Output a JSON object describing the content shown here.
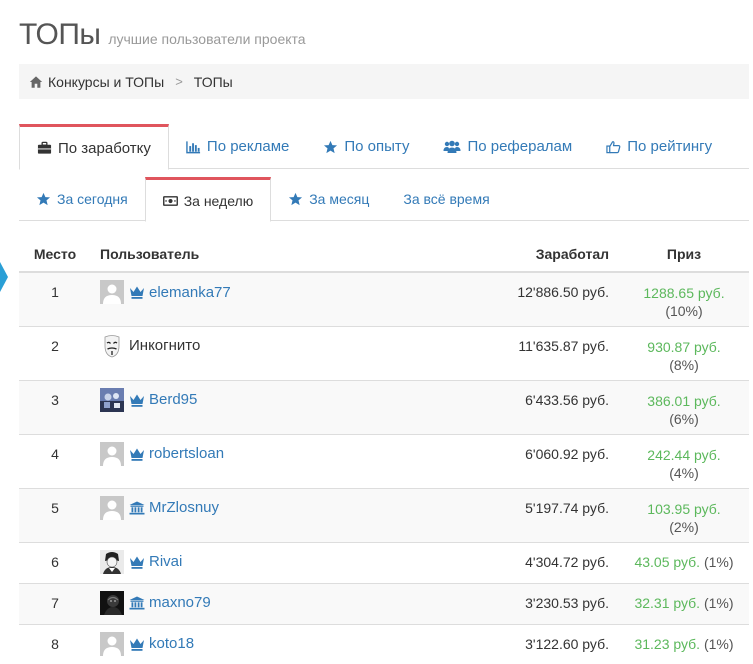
{
  "header": {
    "title": "ТОПы",
    "subtitle": "лучшие пользователи проекта"
  },
  "breadcrumb": {
    "home_label": "Конкурсы и ТОПы",
    "separator": ">",
    "current": "ТОПы"
  },
  "category_tabs": [
    {
      "label": "По заработку",
      "icon": "briefcase-icon",
      "active": true
    },
    {
      "label": "По рекламе",
      "icon": "bar-chart-icon",
      "active": false
    },
    {
      "label": "По опыту",
      "icon": "star-icon",
      "active": false
    },
    {
      "label": "По рефералам",
      "icon": "users-icon",
      "active": false
    },
    {
      "label": "По рейтингу",
      "icon": "thumbs-up-icon",
      "active": false
    }
  ],
  "period_tabs": [
    {
      "label": "За сегодня",
      "icon": "star-icon",
      "active": false
    },
    {
      "label": "За неделю",
      "icon": "money-icon",
      "active": true
    },
    {
      "label": "За месяц",
      "icon": "star-icon",
      "active": false
    },
    {
      "label": "За всё время",
      "icon": "",
      "active": false
    }
  ],
  "table": {
    "headers": {
      "place": "Место",
      "user": "Пользователь",
      "earned": "Заработал",
      "prize": "Приз"
    },
    "rows": [
      {
        "place": "1",
        "avatar": "default-avatar",
        "badge": "crown-icon",
        "name": "elemanka77",
        "earned": "12'886.50 руб.",
        "prize": "1288.65 руб.",
        "pct": "(10%)"
      },
      {
        "place": "2",
        "avatar": "anonymous-mask-avatar",
        "badge": "",
        "name": "Инкогнито",
        "earned": "11'635.87 руб.",
        "prize": "930.87 руб.",
        "pct": "(8%)"
      },
      {
        "place": "3",
        "avatar": "photo-avatar",
        "badge": "crown-icon",
        "name": "Berd95",
        "earned": "6'433.56 руб.",
        "prize": "386.01 руб.",
        "pct": "(6%)"
      },
      {
        "place": "4",
        "avatar": "default-avatar",
        "badge": "crown-icon",
        "name": "robertsloan",
        "earned": "6'060.92 руб.",
        "prize": "242.44 руб.",
        "pct": "(4%)"
      },
      {
        "place": "5",
        "avatar": "default-avatar",
        "badge": "bank-icon",
        "name": "MrZlosnuy",
        "earned": "5'197.74 руб.",
        "prize": "103.95 руб.",
        "pct": "(2%)"
      },
      {
        "place": "6",
        "avatar": "photo-avatar",
        "badge": "crown-icon",
        "name": "Rivai",
        "earned": "4'304.72 руб.",
        "prize": "43.05 руб.",
        "pct": "(1%)"
      },
      {
        "place": "7",
        "avatar": "photo-avatar",
        "badge": "bank-icon",
        "name": "maxno79",
        "earned": "3'230.53 руб.",
        "prize": "32.31 руб.",
        "pct": "(1%)"
      },
      {
        "place": "8",
        "avatar": "default-avatar",
        "badge": "crown-icon",
        "name": "koto18",
        "earned": "3'122.60 руб.",
        "prize": "31.23 руб.",
        "pct": "(1%)"
      }
    ]
  },
  "colors": {
    "link": "#337ab7",
    "active_tab_border": "#e0555d",
    "prize_green": "#5cb85c",
    "breadcrumb_bg": "#f5f5f5"
  }
}
